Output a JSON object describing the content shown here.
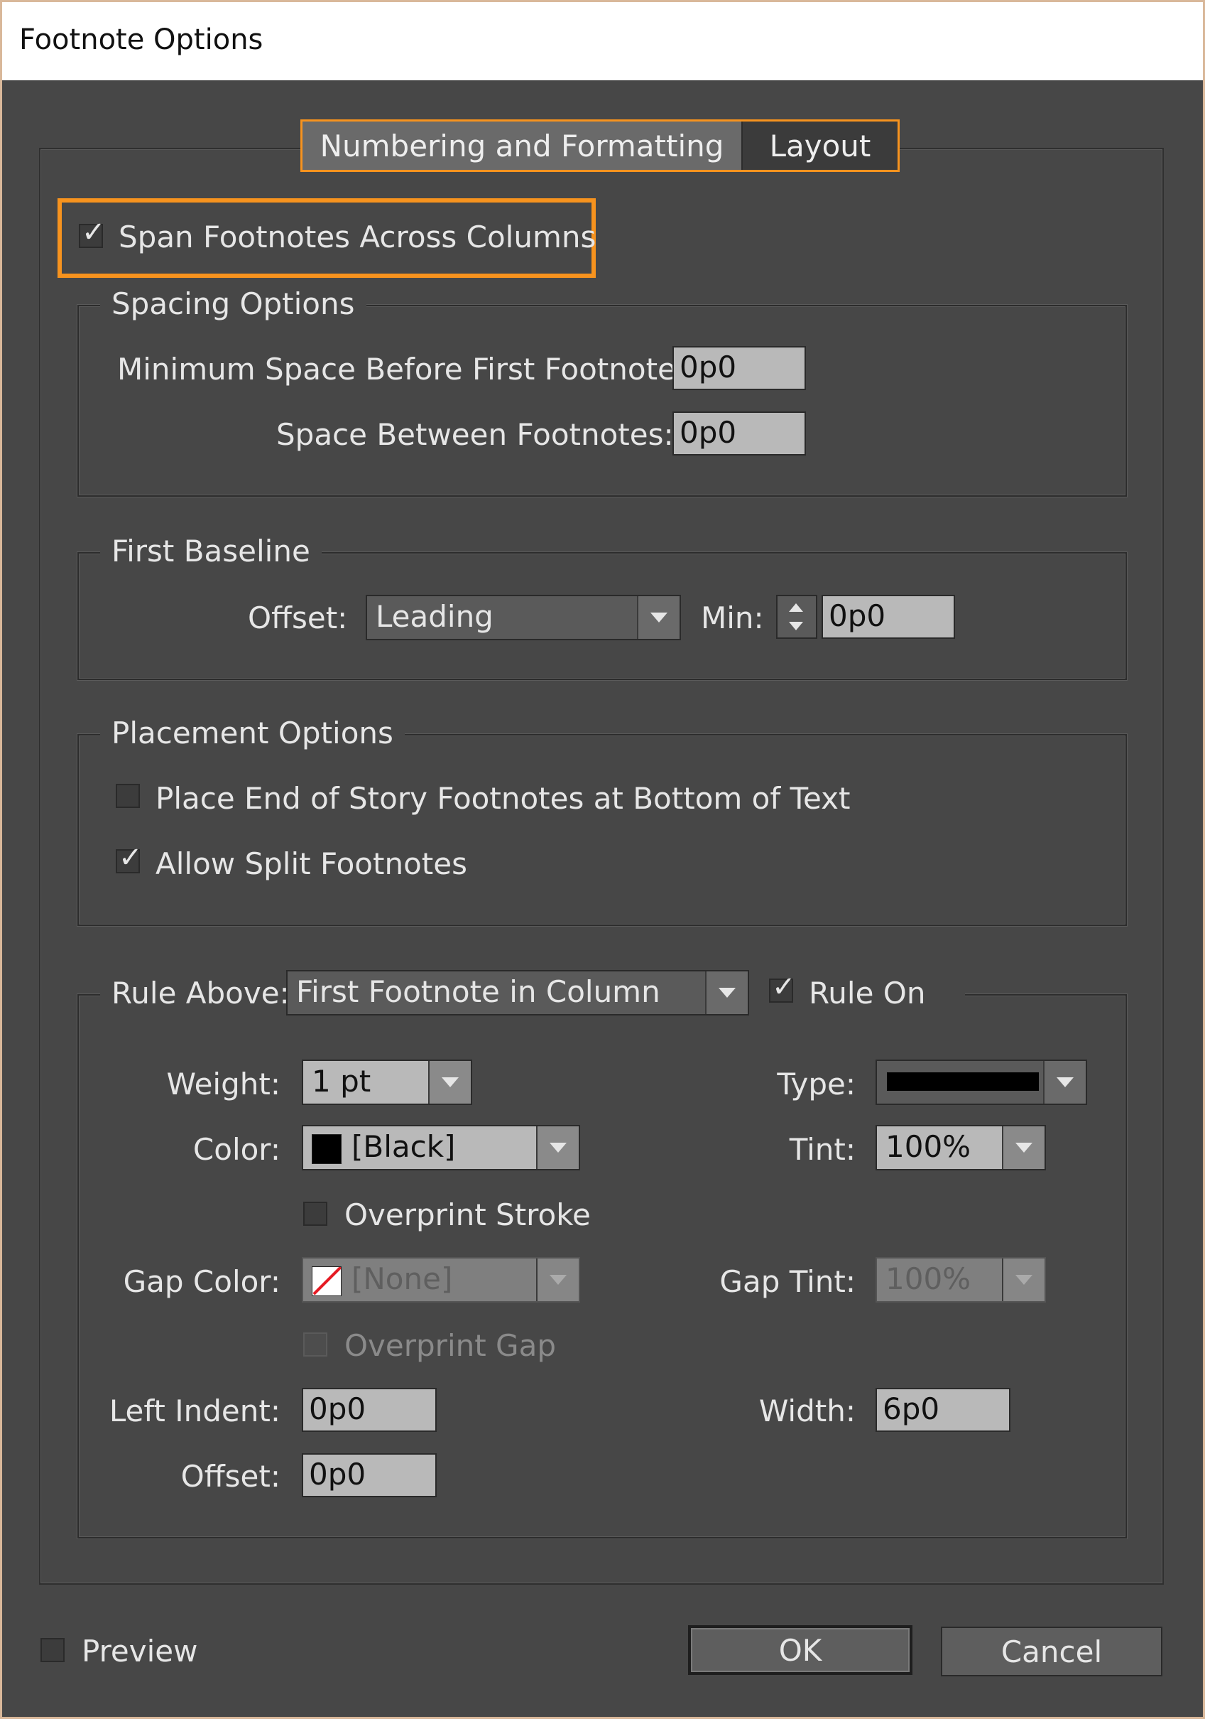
{
  "window": {
    "title": "Footnote Options"
  },
  "tabs": [
    {
      "label": "Numbering and Formatting"
    },
    {
      "label": "Layout"
    }
  ],
  "span": {
    "label": "Span Footnotes Across Columns",
    "checked": true
  },
  "spacing": {
    "legend": "Spacing Options",
    "min_space_label": "Minimum Space Before First Footnote:",
    "min_space_value": "0p0",
    "between_label": "Space Between Footnotes:",
    "between_value": "0p0"
  },
  "baseline": {
    "legend": "First Baseline",
    "offset_label": "Offset:",
    "offset_value": "Leading",
    "min_label": "Min:",
    "min_value": "0p0"
  },
  "placement": {
    "legend": "Placement Options",
    "end_story_label": "Place End of Story Footnotes at Bottom of Text",
    "end_story_checked": false,
    "split_label": "Allow Split Footnotes",
    "split_checked": true
  },
  "rule": {
    "legend": "Rule Above:",
    "above_value": "First Footnote in Column",
    "rule_on_label": "Rule On",
    "rule_on_checked": true,
    "weight_label": "Weight:",
    "weight_value": "1 pt",
    "type_label": "Type:",
    "color_label": "Color:",
    "color_value": "[Black]",
    "tint_label": "Tint:",
    "tint_value": "100%",
    "overprint_stroke_label": "Overprint Stroke",
    "gap_color_label": "Gap Color:",
    "gap_color_value": "[None]",
    "gap_tint_label": "Gap Tint:",
    "gap_tint_value": "100%",
    "overprint_gap_label": "Overprint Gap",
    "left_indent_label": "Left Indent:",
    "left_indent_value": "0p0",
    "width_label": "Width:",
    "width_value": "6p0",
    "offset_label": "Offset:",
    "offset_value": "0p0"
  },
  "footer": {
    "preview_label": "Preview",
    "ok_label": "OK",
    "cancel_label": "Cancel"
  },
  "colors": {
    "accent": "#f7931e",
    "dialog_bg": "#474747"
  }
}
